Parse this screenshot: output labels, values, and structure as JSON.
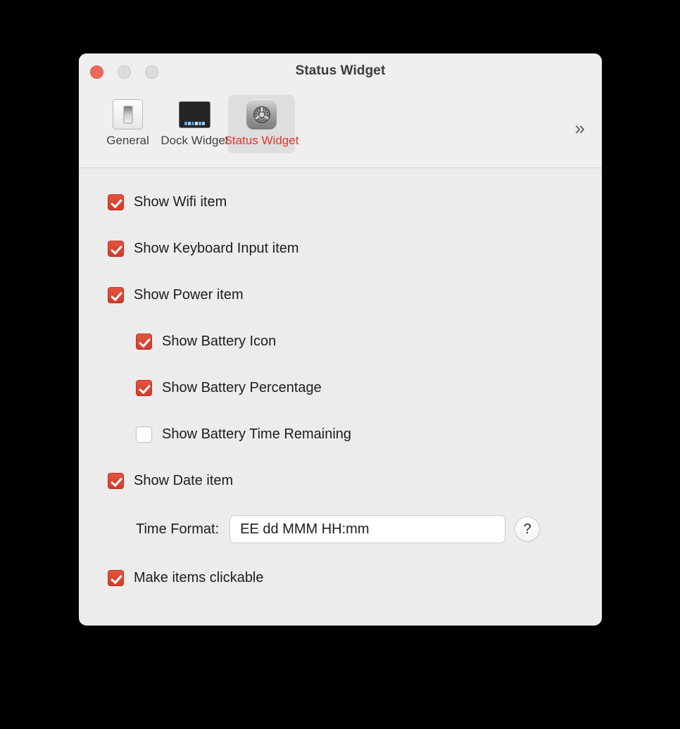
{
  "window": {
    "title": "Status Widget",
    "traffic_lights": [
      {
        "name": "close",
        "color": "#eb6a5c"
      },
      {
        "name": "minimize",
        "color": "#dcdcdc"
      },
      {
        "name": "zoom",
        "color": "#dcdcdc"
      }
    ]
  },
  "toolbar": {
    "overflow_glyph": "»",
    "tabs": [
      {
        "label": "General",
        "icon": "light-switch-icon",
        "selected": false
      },
      {
        "label": "Dock Widget",
        "icon": "dock-screen-icon",
        "selected": false
      },
      {
        "label": "Status Widget",
        "icon": "gear-preferences-icon",
        "selected": true
      }
    ],
    "selected_color": "#e2372c"
  },
  "settings": {
    "rows": [
      {
        "label": "Show Wifi item",
        "checked": true,
        "indent": false
      },
      {
        "label": "Show Keyboard Input item",
        "checked": true,
        "indent": false
      },
      {
        "label": "Show Power item",
        "checked": true,
        "indent": false
      },
      {
        "label": "Show Battery Icon",
        "checked": true,
        "indent": true
      },
      {
        "label": "Show Battery Percentage",
        "checked": true,
        "indent": true
      },
      {
        "label": "Show Battery Time Remaining",
        "checked": false,
        "indent": true
      },
      {
        "label": "Show Date item",
        "checked": true,
        "indent": false
      },
      {
        "label": "Make items clickable",
        "checked": true,
        "indent": false
      }
    ],
    "time_format": {
      "label": "Time Format:",
      "value": "EE dd MMM HH:mm",
      "placeholder": "EE dd MMM HH:mm",
      "help_glyph": "?"
    }
  },
  "colors": {
    "accent_red": "#d23c2a",
    "window_bg": "#ececec",
    "toolbar_bg": "#efefef"
  }
}
